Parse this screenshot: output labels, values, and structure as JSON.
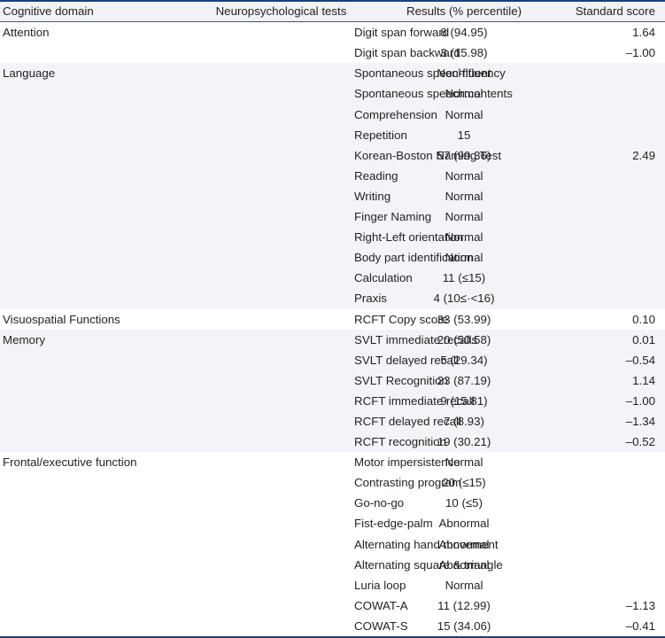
{
  "table": {
    "columns": [
      {
        "key": "domain",
        "label": "Cognitive domain",
        "align": "left"
      },
      {
        "key": "test",
        "label": "Neuropsychological tests",
        "align": "center"
      },
      {
        "key": "result",
        "label": "Results (% percentile)",
        "align": "center"
      },
      {
        "key": "score",
        "label": "Standard score",
        "align": "right"
      }
    ],
    "colors": {
      "rule": "#1f3f7a",
      "header_bg": "#f1f1f6",
      "band_shade": "#f4f3f8",
      "band_plain": "#ffffff",
      "text": "#231f20"
    },
    "rows": [
      {
        "domain": "Attention",
        "test": "Digit span forward",
        "result": "8 (94.95)",
        "score": "1.64",
        "band": "plain"
      },
      {
        "domain": "",
        "test": "Digit span backward",
        "result": "3 (15.98)",
        "score": "–1.00",
        "band": "plain"
      },
      {
        "domain": "Language",
        "test": "Spontaneous speech:fluency",
        "result": "Non-fluent",
        "score": "",
        "band": "shade"
      },
      {
        "domain": "",
        "test": "Spontaneous speech:contents",
        "result": "Normal",
        "score": "",
        "band": "shade"
      },
      {
        "domain": "",
        "test": "Comprehension",
        "result": "Normal",
        "score": "",
        "band": "shade"
      },
      {
        "domain": "",
        "test": "Repetition",
        "result": "15",
        "score": "",
        "band": "shade"
      },
      {
        "domain": "",
        "test": "Korean-Boston Naming Test",
        "result": "57 (99.36)",
        "score": "2.49",
        "band": "shade"
      },
      {
        "domain": "",
        "test": "Reading",
        "result": "Normal",
        "score": "",
        "band": "shade"
      },
      {
        "domain": "",
        "test": "Writing",
        "result": "Normal",
        "score": "",
        "band": "shade"
      },
      {
        "domain": "",
        "test": "Finger Naming",
        "result": "Normal",
        "score": "",
        "band": "shade"
      },
      {
        "domain": "",
        "test": "Right-Left orientation",
        "result": "Normal",
        "score": "",
        "band": "shade"
      },
      {
        "domain": "",
        "test": "Body part identification",
        "result": "Normal",
        "score": "",
        "band": "shade"
      },
      {
        "domain": "",
        "test": "Calculation",
        "result": "11 (≤15)",
        "score": "",
        "band": "shade"
      },
      {
        "domain": "",
        "test": "Praxis",
        "result": "4 (10≤·<16)",
        "score": "",
        "band": "shade"
      },
      {
        "domain": "Visuospatial Functions",
        "test": "RCFT Copy score",
        "result": "33 (53.99)",
        "score": "0.10",
        "band": "plain"
      },
      {
        "domain": "Memory",
        "test": "SVLT immediate recalls",
        "result": "20 (50.58)",
        "score": "0.01",
        "band": "shade"
      },
      {
        "domain": "",
        "test": "SVLT delayed recall",
        "result": "5 (29.34)",
        "score": "–0.54",
        "band": "shade"
      },
      {
        "domain": "",
        "test": "SVLT Recognition",
        "result": "23 (87.19)",
        "score": "1.14",
        "band": "shade"
      },
      {
        "domain": "",
        "test": "RCFT immediate recall",
        "result": "9 (15.81)",
        "score": "–1.00",
        "band": "shade"
      },
      {
        "domain": "",
        "test": "RCFT delayed recall",
        "result": "7 (8.93)",
        "score": "–1.34",
        "band": "shade"
      },
      {
        "domain": "",
        "test": "RCFT recognition",
        "result": "19 (30.21)",
        "score": "–0.52",
        "band": "shade"
      },
      {
        "domain": "Frontal/executive function",
        "test": "Motor impersistence",
        "result": "Normal",
        "score": "",
        "band": "plain"
      },
      {
        "domain": "",
        "test": "Contrasting program",
        "result": "20 (≤15)",
        "score": "",
        "band": "plain"
      },
      {
        "domain": "",
        "test": "Go-no-go",
        "result": "10 (≤5)",
        "score": "",
        "band": "plain"
      },
      {
        "domain": "",
        "test": "Fist-edge-palm",
        "result": "Abnormal",
        "score": "",
        "band": "plain"
      },
      {
        "domain": "",
        "test": "Alternating hand movement",
        "result": "Abnormal",
        "score": "",
        "band": "plain"
      },
      {
        "domain": "",
        "test": "Alternating square & triangle",
        "result": "Abnormal",
        "score": "",
        "band": "plain"
      },
      {
        "domain": "",
        "test": "Luria loop",
        "result": "Normal",
        "score": "",
        "band": "plain"
      },
      {
        "domain": "",
        "test": "COWAT-A",
        "result": "11 (12.99)",
        "score": "–1.13",
        "band": "plain"
      },
      {
        "domain": "",
        "test": "COWAT-S",
        "result": "15 (34.06)",
        "score": "–0.41",
        "band": "plain"
      }
    ]
  }
}
